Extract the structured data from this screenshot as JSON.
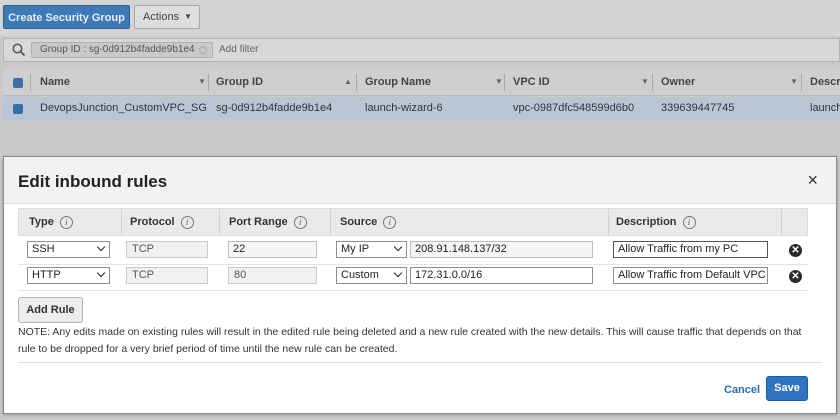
{
  "toolbar": {
    "create_label": "Create Security Group",
    "actions_label": "Actions"
  },
  "filter": {
    "token": "Group ID : sg-0d912b4fadde9b1e4",
    "add_placeholder": "Add filter"
  },
  "grid": {
    "columns": [
      "Name",
      "Group ID",
      "Group Name",
      "VPC ID",
      "Owner",
      "Descri"
    ],
    "row": {
      "name": "DevopsJunction_CustomVPC_SG",
      "group_id": "sg-0d912b4fadde9b1e4",
      "group_name": "launch-wizard-6",
      "vpc_id": "vpc-0987dfc548599d6b0",
      "owner": "339639447745",
      "description": "launch-"
    }
  },
  "modal": {
    "title": "Edit inbound rules",
    "close": "×",
    "headers": {
      "type": "Type",
      "protocol": "Protocol",
      "port_range": "Port Range",
      "source": "Source",
      "description": "Description"
    },
    "info_glyph": "i",
    "rules": [
      {
        "type": "SSH",
        "protocol": "TCP",
        "port": "22",
        "source_type": "My IP",
        "source": "208.91.148.137/32",
        "description": "Allow Traffic from my PC"
      },
      {
        "type": "HTTP",
        "protocol": "TCP",
        "port": "80",
        "source_type": "Custom",
        "source": "172.31.0.0/16",
        "description": "Allow Traffic from Default VPC"
      }
    ],
    "add_rule": "Add Rule",
    "note": "NOTE: Any edits made on existing rules will result in the edited rule being deleted and a new rule created with the new details. This will cause traffic that depends on that rule to be dropped for a very brief period of time until the new rule can be created.",
    "cancel": "Cancel",
    "save": "Save"
  },
  "colors": {
    "primary": "#2f74c0",
    "link": "#2a6cb0",
    "row_selected": "#b9c6d6",
    "overlay": "#c9c9c9"
  }
}
